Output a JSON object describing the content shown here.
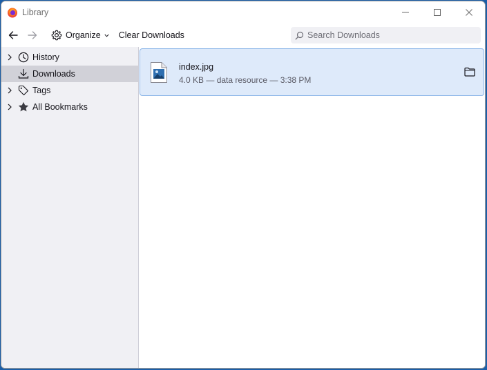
{
  "window": {
    "title": "Library"
  },
  "toolbar": {
    "back_icon": "arrow-left-icon",
    "forward_icon": "arrow-right-icon",
    "organize_label": "Organize",
    "clear_downloads_label": "Clear Downloads"
  },
  "search": {
    "placeholder": "Search Downloads",
    "value": ""
  },
  "sidebar": {
    "items": [
      {
        "label": "History",
        "icon": "clock-icon",
        "expandable": true,
        "selected": false
      },
      {
        "label": "Downloads",
        "icon": "download-icon",
        "expandable": false,
        "selected": true
      },
      {
        "label": "Tags",
        "icon": "tag-icon",
        "expandable": true,
        "selected": false
      },
      {
        "label": "All Bookmarks",
        "icon": "star-icon",
        "expandable": true,
        "selected": false
      }
    ]
  },
  "downloads": [
    {
      "name": "index.jpg",
      "status": "4.0 KB — data resource — 3:38 PM",
      "icon": "image-file-icon"
    }
  ],
  "colors": {
    "selection_bg": "#deeafa",
    "selection_border": "#8cb6e8",
    "sidebar_bg": "#f0f0f4",
    "sidebar_selected": "#d1d1d8"
  }
}
